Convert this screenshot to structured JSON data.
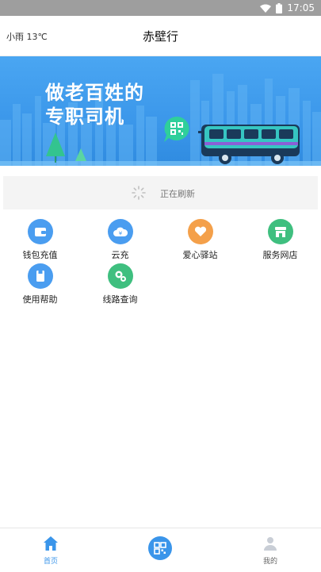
{
  "status_bar": {
    "time": "17:05",
    "icons": [
      "wifi-icon",
      "battery-icon"
    ]
  },
  "header": {
    "weather": "小雨 13℃",
    "title": "赤壁行"
  },
  "banner": {
    "line1": "做老百姓的",
    "line2": "专职司机",
    "icons": [
      "qr-chat-icon",
      "bus-icon"
    ]
  },
  "refresh": {
    "text": "正在刷新"
  },
  "grid": {
    "items": [
      {
        "label": "钱包充值",
        "icon": "wallet-icon",
        "color": "#4a9df0"
      },
      {
        "label": "云充",
        "icon": "yen-cloud-icon",
        "color": "#4a9df0"
      },
      {
        "label": "爱心驿站",
        "icon": "heart-icon",
        "color": "#f4a04a"
      },
      {
        "label": "服务网店",
        "icon": "shop-icon",
        "color": "#3fbf7f"
      },
      {
        "label": "使用帮助",
        "icon": "help-icon",
        "color": "#4a9df0"
      },
      {
        "label": "线路查询",
        "icon": "route-icon",
        "color": "#3fbf7f"
      }
    ]
  },
  "tabbar": {
    "tabs": [
      {
        "label": "首页",
        "icon": "home-icon",
        "active": true
      },
      {
        "label": "",
        "icon": "qr-scan-icon",
        "active": false
      },
      {
        "label": "我的",
        "icon": "user-icon",
        "active": false
      }
    ],
    "active_color": "#3a95ea",
    "inactive_color": "#888888"
  }
}
